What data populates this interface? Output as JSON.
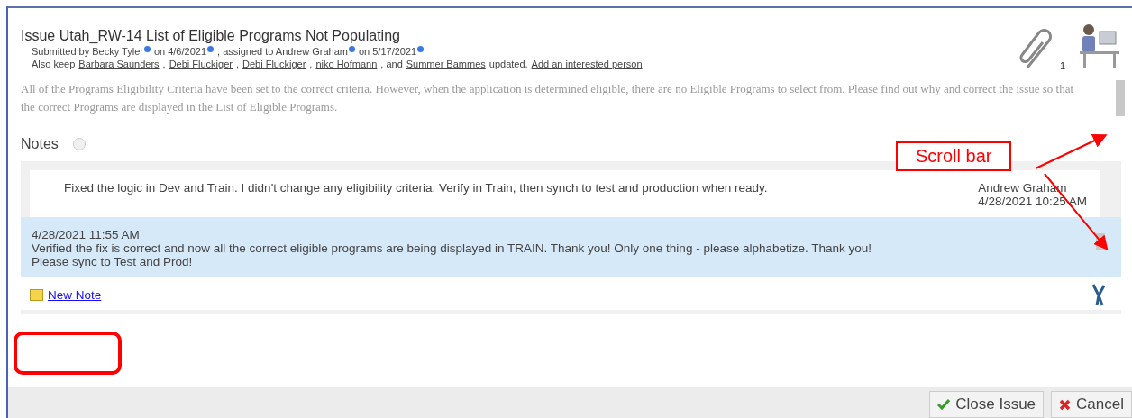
{
  "issue": {
    "title": "Issue Utah_RW-14 List of Eligible Programs Not Populating",
    "submitted": [
      {
        "text": "Submitted by Becky Tyler",
        "info": true
      },
      {
        "text": "on 4/6/2021",
        "info": true
      },
      {
        "text": ", assigned to Andrew Graham",
        "info": true
      },
      {
        "text": "on 5/17/2021",
        "info": true
      }
    ],
    "also_keep": [
      {
        "kind": "text",
        "text": "Also keep"
      },
      {
        "kind": "link",
        "text": "Barbara Saunders"
      },
      {
        "kind": "text",
        "text": ","
      },
      {
        "kind": "link",
        "text": "Debi Fluckiger"
      },
      {
        "kind": "text",
        "text": ","
      },
      {
        "kind": "link",
        "text": "Debi Fluckiger"
      },
      {
        "kind": "text",
        "text": ","
      },
      {
        "kind": "link",
        "text": "niko Hofmann"
      },
      {
        "kind": "text",
        "text": ", and"
      },
      {
        "kind": "link",
        "text": "Summer Bammes"
      },
      {
        "kind": "text",
        "text": "updated."
      },
      {
        "kind": "link",
        "text": "Add an interested person"
      }
    ],
    "attachment_count": "1",
    "description": "All of the Programs Eligibility Criteria have been set to the correct criteria. However, when the application is determined eligible, there are no Eligible Programs to select from. Please find out why and correct the issue so that the correct Programs are displayed in the List of Eligible Programs."
  },
  "notes": {
    "heading": "Notes",
    "items": [
      {
        "kind": "plain",
        "text": "Fixed the logic in Dev and Train.  I didn't change any eligibility criteria.  Verify in Train, then synch to test and production when ready.",
        "author": "Andrew Graham",
        "time": "4/28/2021 10:25 AM"
      },
      {
        "kind": "highlighted",
        "time": "4/28/2021 11:55 AM",
        "lines": [
          "Verified the fix is correct and now all the correct eligible programs are being displayed in TRAIN. Thank you! Only one thing - please alphabetize. Thank you!",
          "Please sync to Test and Prod!"
        ]
      }
    ],
    "new_note": "New Note"
  },
  "buttons": [
    {
      "kind": "confirm",
      "label": "Close Issue"
    },
    {
      "kind": "cancel",
      "label": "Cancel"
    }
  ],
  "annotations": [
    {
      "kind": "callout",
      "text": "Scroll bar"
    },
    {
      "kind": "highlight"
    }
  ]
}
